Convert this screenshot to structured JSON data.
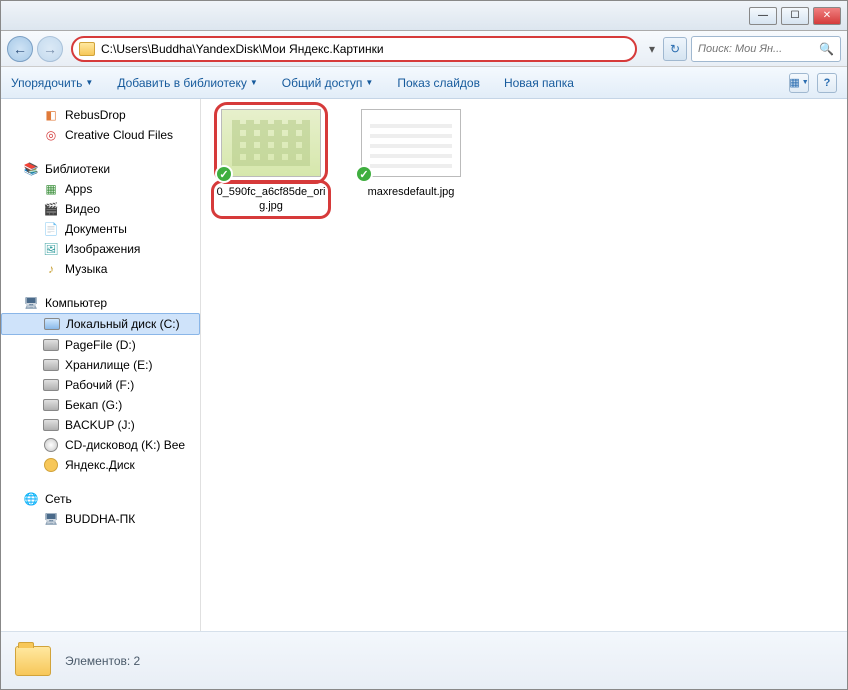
{
  "window": {
    "address_path": "C:\\Users\\Buddha\\YandexDisk\\Мои Яндекс.Картинки",
    "search_placeholder": "Поиск: Мои Ян..."
  },
  "toolbar": {
    "organize": "Упорядочить",
    "library": "Добавить в библиотеку",
    "share": "Общий доступ",
    "slideshow": "Показ слайдов",
    "new_folder": "Новая папка"
  },
  "sidebar": {
    "rebus": "RebusDrop",
    "cloud": "Creative Cloud Files",
    "libraries": "Библиотеки",
    "apps": "Apps",
    "video": "Видео",
    "documents": "Документы",
    "images": "Изображения",
    "music": "Музыка",
    "computer": "Компьютер",
    "drive_c": "Локальный диск (C:)",
    "pagefile": "PageFile (D:)",
    "storage": "Хранилище (E:)",
    "work": "Рабочий (F:)",
    "backup_g": "Бекап (G:)",
    "backup_j": "BACKUP (J:)",
    "cdrom": "CD-дисковод (K:) Bee",
    "ydisk": "Яндекс.Диск",
    "network": "Сеть",
    "buddha_pc": "BUDDHA-ПК"
  },
  "files": [
    {
      "name": "0_590fc_a6cf85de_orig.jpg",
      "synced": true,
      "highlighted": true,
      "thumb": "t1"
    },
    {
      "name": "maxresdefault.jpg",
      "synced": true,
      "highlighted": false,
      "thumb": "t2"
    }
  ],
  "status": {
    "text": "Элементов: 2"
  }
}
